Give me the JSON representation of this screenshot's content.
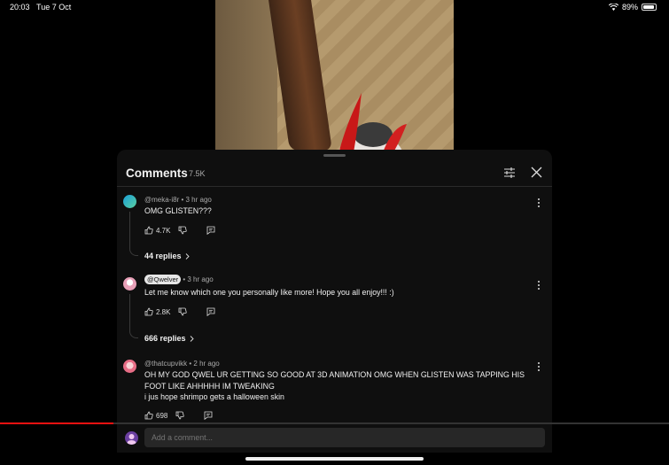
{
  "status": {
    "time": "20:03",
    "date": "Tue 7 Oct",
    "battery": "89%",
    "battery_level": 0.89
  },
  "comments_panel": {
    "title": "Comments",
    "count": "7.5K",
    "comments": [
      {
        "author": "@meka-i8r",
        "time": "3 hr ago",
        "lines": [
          "OMG GLISTEN???"
        ],
        "likes": "4.7K",
        "replies": "44 replies"
      },
      {
        "author": "@Qwelver",
        "time": "3 hr ago",
        "lines": [
          "Let me know which one you personally like more! Hope you all enjoy!!! :)"
        ],
        "likes": "2.8K",
        "replies": "666 replies"
      },
      {
        "author": "@thatcupvikk",
        "time": "2 hr ago",
        "lines": [
          "OH MY GOD QWEL UR GETTING SO GOOD AT 3D ANIMATION OMG WHEN GLISTEN WAS TAPPING HIS",
          "FOOT LIKE AHHHHH IM TWEAKING",
          "i jus hope shrimpo gets a halloween skin"
        ],
        "likes": "698"
      }
    ],
    "add_comment_placeholder": "Add a comment..."
  },
  "video_progress": 0.17,
  "icons": [
    "wifi-icon",
    "battery-icon",
    "filter-icon",
    "close-icon",
    "like-icon",
    "dislike-icon",
    "reply-icon",
    "more-vert-icon",
    "chevron-right-icon"
  ]
}
